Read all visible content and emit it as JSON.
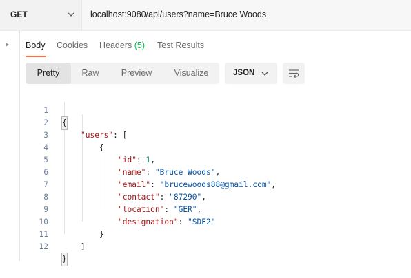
{
  "request": {
    "method": "GET",
    "url": "localhost:9080/api/users?name=Bruce Woods"
  },
  "tabs": {
    "body": "Body",
    "cookies": "Cookies",
    "headers": "Headers",
    "headers_count": "(5)",
    "test_results": "Test Results"
  },
  "format": {
    "pretty": "Pretty",
    "raw": "Raw",
    "preview": "Preview",
    "visualize": "Visualize",
    "language": "JSON"
  },
  "code": {
    "line_numbers": [
      "1",
      "2",
      "3",
      "4",
      "5",
      "6",
      "7",
      "8",
      "9",
      "10",
      "11",
      "12"
    ],
    "l1": "{",
    "users_key": "\"users\"",
    "users_open": ": [",
    "obj_open": "{",
    "id_key": "\"id\"",
    "id_val": "1",
    "name_key": "\"name\"",
    "name_val": "\"Bruce Woods\"",
    "email_key": "\"email\"",
    "email_val": "\"brucewoods88@gmail.com\"",
    "contact_key": "\"contact\"",
    "contact_val": "\"87290\"",
    "location_key": "\"location\"",
    "location_val": "\"GER\"",
    "designation_key": "\"designation\"",
    "designation_val": "\"SDE2\"",
    "obj_close": "}",
    "arr_close": "]",
    "l12": "}"
  },
  "colors": {
    "accent": "#ff6c37",
    "count": "#0cbb52",
    "key": "#a31515",
    "string": "#0451a5",
    "number": "#098658"
  },
  "icons": [
    "chevron-down-icon",
    "expand-arrow-icon",
    "wrap-lines-icon"
  ]
}
